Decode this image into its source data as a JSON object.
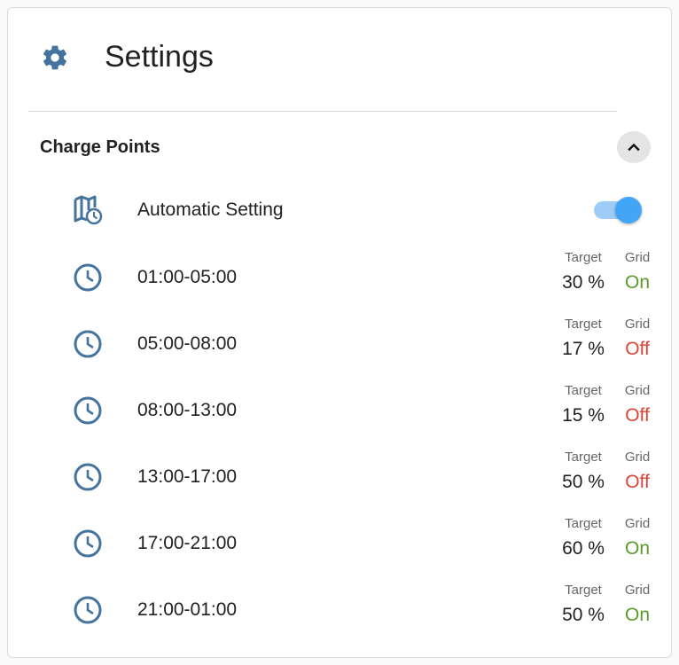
{
  "header": {
    "title": "Settings",
    "icon": "gear-icon"
  },
  "section": {
    "title": "Charge Points",
    "collapse_icon": "chevron-up-icon"
  },
  "automatic": {
    "label": "Automatic Setting",
    "enabled": true,
    "icon": "map-clock-icon"
  },
  "labels": {
    "target": "Target",
    "grid": "Grid"
  },
  "schedules": [
    {
      "time": "01:00-05:00",
      "target": "30 %",
      "grid": "On"
    },
    {
      "time": "05:00-08:00",
      "target": "17 %",
      "grid": "Off"
    },
    {
      "time": "08:00-13:00",
      "target": "15 %",
      "grid": "Off"
    },
    {
      "time": "13:00-17:00",
      "target": "50 %",
      "grid": "Off"
    },
    {
      "time": "17:00-21:00",
      "target": "60 %",
      "grid": "On"
    },
    {
      "time": "21:00-01:00",
      "target": "50 %",
      "grid": "On"
    }
  ],
  "colors": {
    "icon": "#44739e",
    "toggle": "#42a5f5",
    "on": "#5a9a2b",
    "off": "#db4437"
  }
}
